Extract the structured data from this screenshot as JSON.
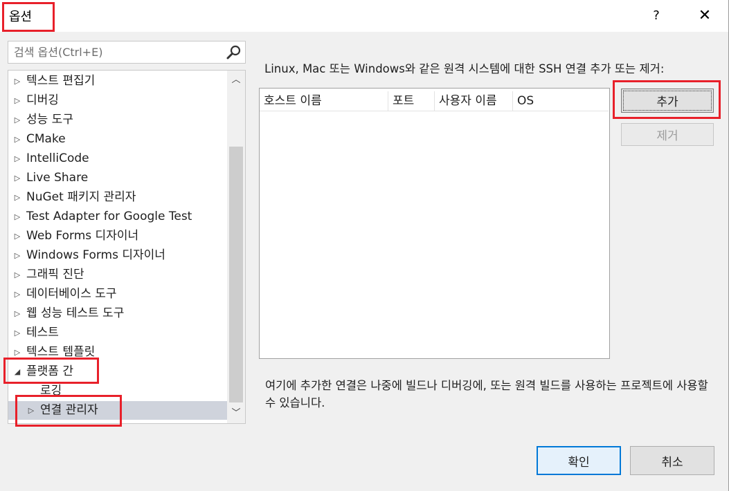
{
  "window": {
    "title": "옵션",
    "help_label": "?",
    "close_label": "✕"
  },
  "search": {
    "placeholder": "검색 옵션(Ctrl+E)"
  },
  "tree": {
    "items": [
      {
        "label": "텍스트 편집기",
        "arrow": "▷"
      },
      {
        "label": "디버깅",
        "arrow": "▷"
      },
      {
        "label": "성능 도구",
        "arrow": "▷"
      },
      {
        "label": "CMake",
        "arrow": "▷"
      },
      {
        "label": "IntelliCode",
        "arrow": "▷"
      },
      {
        "label": "Live Share",
        "arrow": "▷"
      },
      {
        "label": "NuGet 패키지 관리자",
        "arrow": "▷"
      },
      {
        "label": "Test Adapter for Google Test",
        "arrow": "▷"
      },
      {
        "label": "Web Forms 디자이너",
        "arrow": "▷"
      },
      {
        "label": "Windows Forms 디자이너",
        "arrow": "▷"
      },
      {
        "label": "그래픽 진단",
        "arrow": "▷"
      },
      {
        "label": "데이터베이스 도구",
        "arrow": "▷"
      },
      {
        "label": "웹 성능 테스트 도구",
        "arrow": "▷"
      },
      {
        "label": "테스트",
        "arrow": "▷"
      },
      {
        "label": "텍스트 템플릿",
        "arrow": "▷"
      },
      {
        "label": "플랫폼 간",
        "arrow": "◢"
      },
      {
        "label": "로깅",
        "arrow": ""
      },
      {
        "label": "연결 관리자",
        "arrow": "▷"
      }
    ],
    "scroll_up": "︿",
    "scroll_down": "﹀"
  },
  "main": {
    "description": "Linux, Mac 또는 Windows와 같은 원격 시스템에 대한 SSH 연결 추가 또는 제거:",
    "table": {
      "columns": [
        "호스트 이름",
        "포트",
        "사용자 이름",
        "OS"
      ]
    },
    "add_label": "추가",
    "remove_label": "제거",
    "note": "여기에 추가한 연결은 나중에 빌드나 디버깅에, 또는 원격 빌드를 사용하는 프로젝트에 사용할 수 있습니다."
  },
  "footer": {
    "ok_label": "확인",
    "cancel_label": "취소"
  },
  "colors": {
    "highlight": "#e8202a",
    "accent": "#0078d7",
    "selected_bg": "#cfd3dc"
  }
}
